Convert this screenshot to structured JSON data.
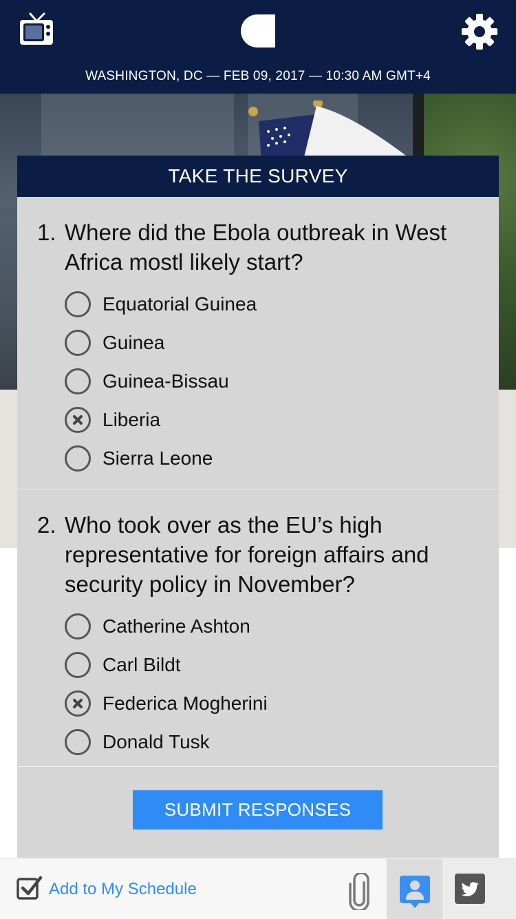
{
  "header": {
    "dateline": "WASHINGTON, DC — FEB 09, 2017 — 10:30 AM GMT+4",
    "icons": [
      "tv-icon",
      "logo-icon",
      "gear-icon"
    ]
  },
  "survey": {
    "title": "TAKE THE SURVEY",
    "questions": [
      {
        "number": "1.",
        "text": "Where did the Ebola outbreak in West Africa mostl likely start?",
        "options": [
          {
            "label": "Equatorial Guinea",
            "selected": false
          },
          {
            "label": "Guinea",
            "selected": false
          },
          {
            "label": "Guinea-Bissau",
            "selected": false
          },
          {
            "label": "Liberia",
            "selected": true
          },
          {
            "label": "Sierra Leone",
            "selected": false
          }
        ]
      },
      {
        "number": "2.",
        "text": "Who took over as the EU’s high representative for foreign affairs and security policy in November?",
        "options": [
          {
            "label": "Catherine Ashton",
            "selected": false
          },
          {
            "label": "Carl Bildt",
            "selected": false
          },
          {
            "label": "Federica Mogherini",
            "selected": true
          },
          {
            "label": "Donald Tusk",
            "selected": false
          }
        ]
      }
    ],
    "submit_label": "SUBMIT RESPONSES"
  },
  "bottom_bar": {
    "schedule_label": "Add to My Schedule",
    "icons": [
      "checkbox-icon",
      "paperclip-icon",
      "person-icon",
      "twitter-icon"
    ]
  },
  "colors": {
    "navy": "#0c1d45",
    "accent_blue": "#2f8cf6",
    "card_gray": "#d6d6d6"
  }
}
